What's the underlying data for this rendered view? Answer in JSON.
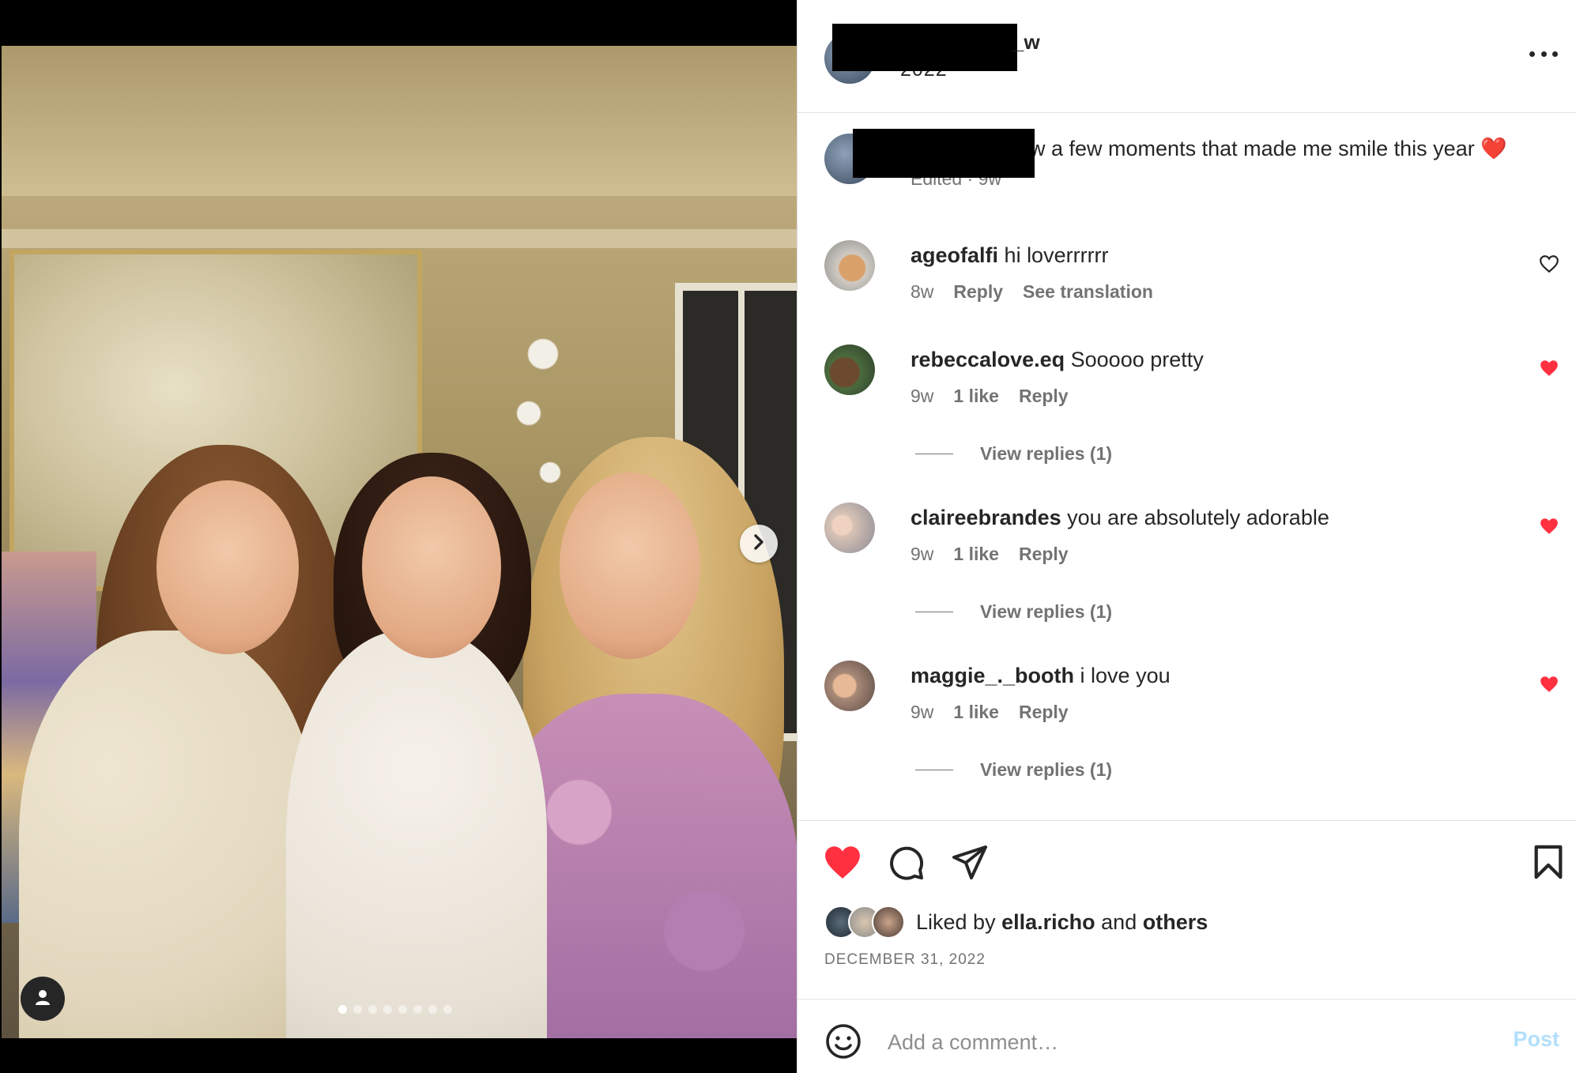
{
  "media": {
    "carousel_count": 8,
    "carousel_active_index": 0
  },
  "header": {
    "username_suffix": "_w",
    "subtitle": "2022"
  },
  "caption": {
    "text": "w a few moments that made me smile this year ❤️",
    "meta": "Edited · 9w"
  },
  "comments": [
    {
      "username": "ageofalfi",
      "text": "hi loverrrrrr",
      "time": "8w",
      "likes": "",
      "reply": "Reply",
      "translate": "See translation",
      "liked": false,
      "view_replies": ""
    },
    {
      "username": "rebeccalove.eq",
      "text": "Sooooo pretty",
      "time": "9w",
      "likes": "1 like",
      "reply": "Reply",
      "translate": "",
      "liked": true,
      "view_replies": "View replies (1)"
    },
    {
      "username": "claireebrandes",
      "text": "you are absolutely adorable",
      "time": "9w",
      "likes": "1 like",
      "reply": "Reply",
      "translate": "",
      "liked": true,
      "view_replies": "View replies (1)"
    },
    {
      "username": "maggie_._booth",
      "text": "i love you",
      "time": "9w",
      "likes": "1 like",
      "reply": "Reply",
      "translate": "",
      "liked": true,
      "view_replies": "View replies (1)"
    }
  ],
  "likes": {
    "prefix": "Liked by",
    "user": "ella.richo",
    "joiner": "and",
    "others": "others"
  },
  "post_date": "DECEMBER 31, 2022",
  "comment_box": {
    "placeholder": "Add a comment…",
    "post_label": "Post"
  },
  "colors": {
    "like_red": "#ff3040",
    "muted_text": "#737373",
    "post_button_disabled": "#b2dffc"
  },
  "icons": {
    "like": "heart-filled",
    "comment": "speech-bubble",
    "share": "paper-plane",
    "save": "bookmark",
    "emoji": "smiley",
    "more": "three-dots",
    "next": "chevron-right",
    "tag": "person"
  }
}
